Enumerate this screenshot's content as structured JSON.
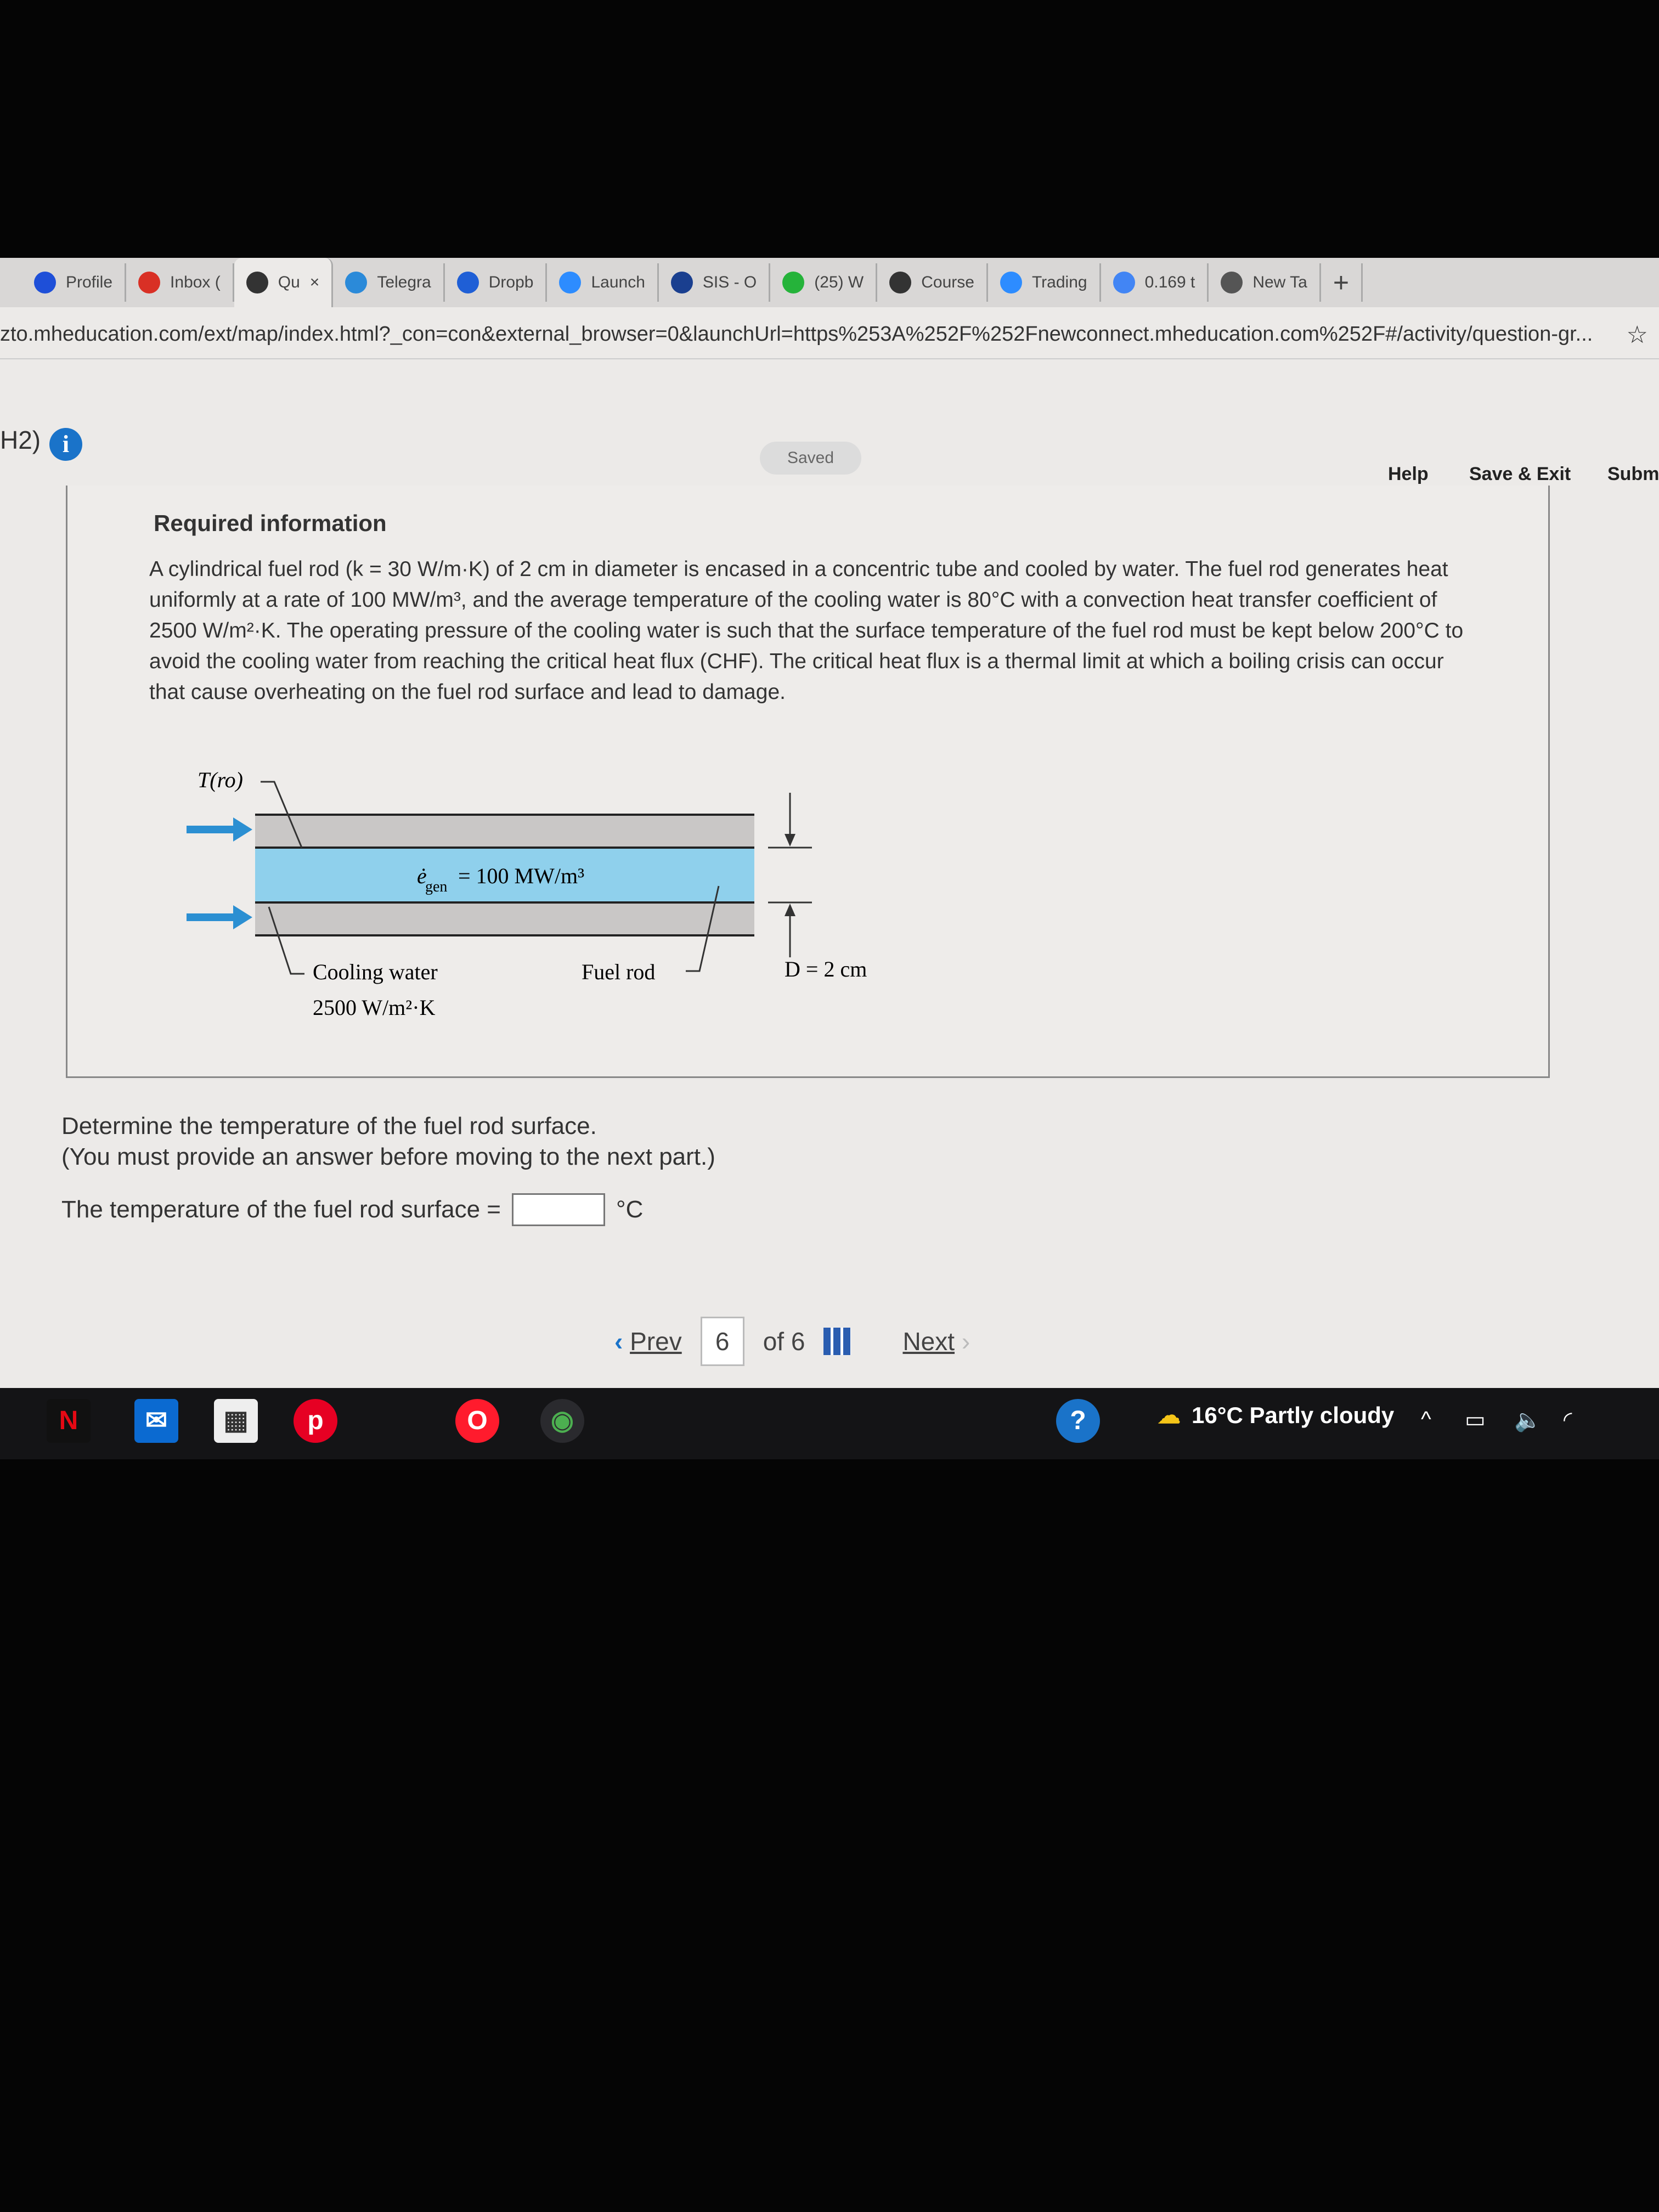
{
  "browser": {
    "tabs": [
      {
        "label": "Profile",
        "icon": "profile-icon",
        "color": "#1e4fd8"
      },
      {
        "label": "Inbox (",
        "icon": "gmail-icon",
        "color": "#d93025"
      },
      {
        "label": "Qu",
        "icon": "quizlet-icon",
        "color": "#333333",
        "active": true
      },
      {
        "label": "Telegra",
        "icon": "telegram-icon",
        "color": "#2b8ad9"
      },
      {
        "label": "Dropb",
        "icon": "dropbox-icon",
        "color": "#1f5fd6"
      },
      {
        "label": "Launch",
        "icon": "zoom-icon",
        "color": "#2d8cff"
      },
      {
        "label": "SIS - O",
        "icon": "sis-icon",
        "color": "#1a3f8f"
      },
      {
        "label": "(25) W",
        "icon": "whatsapp-icon",
        "color": "#25b33a"
      },
      {
        "label": "Course",
        "icon": "course-icon",
        "color": "#333333"
      },
      {
        "label": "Trading",
        "icon": "zoom-icon",
        "color": "#2d8cff"
      },
      {
        "label": "0.169 t",
        "icon": "google-icon",
        "color": "#4285f4"
      },
      {
        "label": "New Ta",
        "icon": "new-tab-icon",
        "color": "#555555"
      }
    ],
    "close_tab": "×",
    "new_tab": "+",
    "url": "zto.mheducation.com/ext/map/index.html?_con=con&external_browser=0&launchUrl=https%253A%252F%252Fnewconnect.mheducation.com%252F#/activity/question-gr..."
  },
  "header": {
    "section": "H2)",
    "status": "Saved",
    "help": "Help",
    "save_exit": "Save & Exit",
    "submit": "Subm"
  },
  "problem": {
    "title": "Required information",
    "text": "A cylindrical fuel rod (k = 30 W/m·K) of 2 cm in diameter is encased in a concentric tube and cooled by water. The fuel rod generates heat uniformly at a rate of 100 MW/m³, and the average temperature of the cooling water is 80°C with a convection heat transfer coefficient of 2500 W/m²·K. The operating pressure of the cooling water is such that the surface temperature of the fuel rod must be kept below 200°C to avoid the cooling water from reaching the critical heat flux (CHF). The critical heat flux is a thermal limit at which a boiling crisis can occur that cause overheating on the fuel rod surface and lead to damage."
  },
  "diagram": {
    "surface_temp_label": "T(ro)",
    "generation_label": "ė",
    "generation_sub": "gen",
    "generation_value": "= 100 MW/m³",
    "cooling_water_label": "Cooling water",
    "h_value": "2500 W/m²·K",
    "fuel_rod_label": "Fuel rod",
    "diameter_label": "D = 2 cm",
    "colors": {
      "rod": "#8fd0ec",
      "water": "#c9c7c6",
      "arrow": "#2b8fd2"
    }
  },
  "question": {
    "line1": "Determine the temperature of the fuel rod surface.",
    "line2": "(You must provide an answer before moving to the next part.)",
    "answer_label": "The temperature of the fuel rod surface =",
    "answer_value": "",
    "unit": "°C"
  },
  "pager": {
    "prev": "Prev",
    "current": "6",
    "of": "of 6",
    "next": "Next"
  },
  "taskbar": {
    "weather": "16°C  Partly cloudy"
  }
}
